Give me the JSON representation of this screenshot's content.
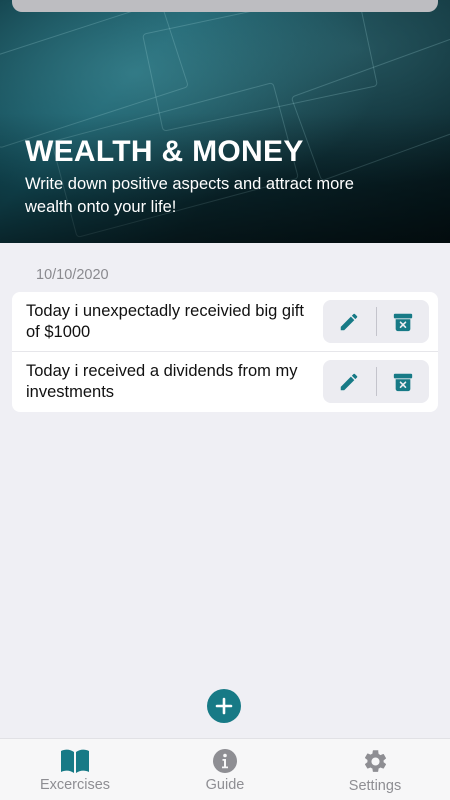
{
  "hero": {
    "title": "WEALTH & MONEY",
    "subtitle": "Write down positive aspects and attract more wealth onto your life!"
  },
  "entries": {
    "date": "10/10/2020",
    "items": [
      {
        "text": "Today i unexpectadly receivied big gift of $1000",
        "edit_icon": "pencil-icon",
        "delete_icon": "trash-icon"
      },
      {
        "text": "Today i received a dividends from my investments",
        "edit_icon": "pencil-icon",
        "delete_icon": "trash-icon"
      }
    ]
  },
  "add_button": {
    "icon": "plus-icon"
  },
  "tabbar": {
    "tabs": [
      {
        "label": "Excercises",
        "icon": "book-icon"
      },
      {
        "label": "Guide",
        "icon": "info-icon"
      },
      {
        "label": "Settings",
        "icon": "gear-icon"
      }
    ]
  },
  "colors": {
    "accent": "#177a86",
    "tab_inactive": "#8e8e93",
    "background": "#efeff4"
  }
}
